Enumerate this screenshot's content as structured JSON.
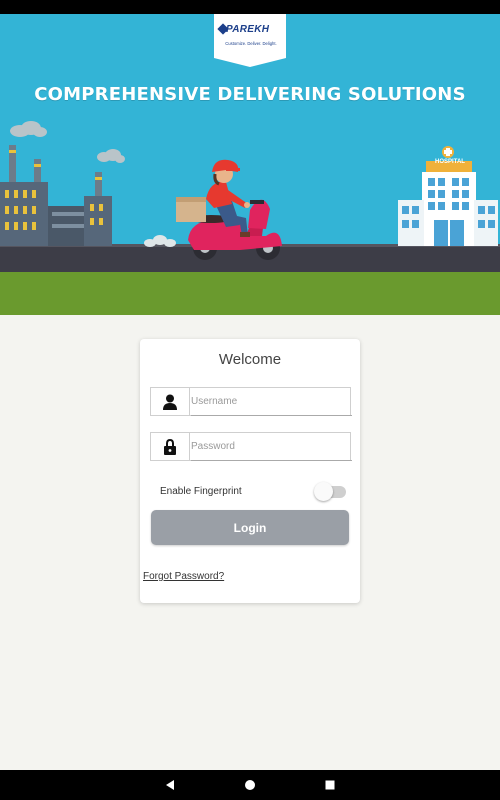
{
  "brand": {
    "name": "PAREKH",
    "tagline": "Customize. Deliver. Delight."
  },
  "hero": {
    "title": "COMPREHENSIVE DELIVERING SOLUTIONS",
    "hospital_sign": "HOSPITAL"
  },
  "login": {
    "welcome": "Welcome",
    "username_placeholder": "Username",
    "password_placeholder": "Password",
    "fingerprint_label": "Enable Fingerprint",
    "fingerprint_enabled": false,
    "login_label": "Login",
    "forgot_label": "Forgot Password?"
  },
  "icons": {
    "username": "user-icon",
    "password": "lock-icon",
    "back": "back-icon",
    "home": "home-icon",
    "recents": "recents-icon"
  },
  "colors": {
    "sky": "#33b4d6",
    "grass": "#6a9a2e",
    "road": "#3d3d47",
    "button": "#9a9fa6",
    "scooter": "#e0245e",
    "rider_shirt": "#e6392f"
  }
}
